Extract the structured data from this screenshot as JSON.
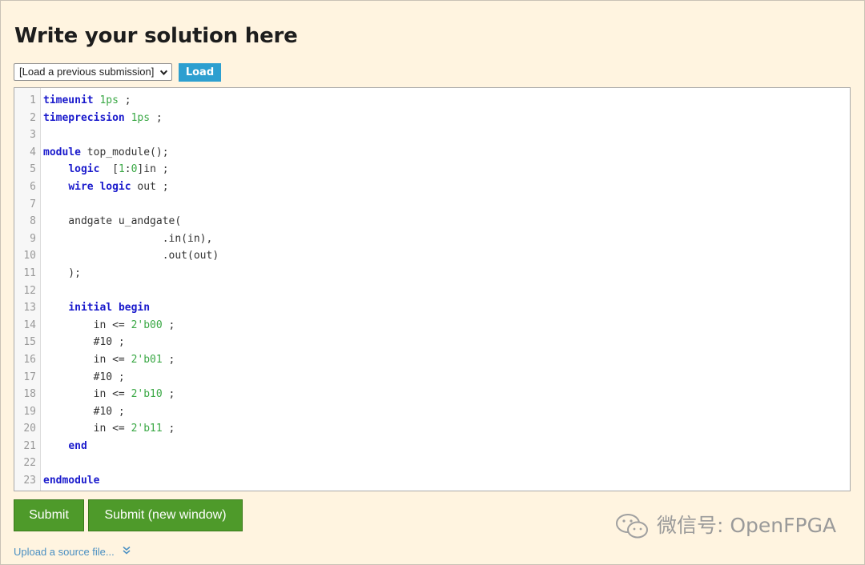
{
  "page": {
    "title": "Write your solution here"
  },
  "load_bar": {
    "select_value": "[Load a previous submission]",
    "load_label": "Load"
  },
  "editor": {
    "lines": [
      {
        "n": "1",
        "html": "<span class=\"kw\">timeunit</span> <span class=\"num\">1ps</span> ;"
      },
      {
        "n": "2",
        "html": "<span class=\"kw\">timeprecision</span> <span class=\"num\">1ps</span> ;"
      },
      {
        "n": "3",
        "html": ""
      },
      {
        "n": "4",
        "html": "<span class=\"kw\">module</span> top_module();"
      },
      {
        "n": "5",
        "html": "    <span class=\"kw\">logic</span>  [<span class=\"num\">1</span>:<span class=\"num\">0</span>]in ;"
      },
      {
        "n": "6",
        "html": "    <span class=\"kw\">wire</span> <span class=\"kw\">logic</span> out ;"
      },
      {
        "n": "7",
        "html": ""
      },
      {
        "n": "8",
        "html": "    andgate u_andgate("
      },
      {
        "n": "9",
        "html": "                   .in(in),"
      },
      {
        "n": "10",
        "html": "                   .out(out)"
      },
      {
        "n": "11",
        "html": "    );"
      },
      {
        "n": "12",
        "html": ""
      },
      {
        "n": "13",
        "html": "    <span class=\"kw\">initial</span> <span class=\"kw\">begin</span>"
      },
      {
        "n": "14",
        "html": "        in <= <span class=\"num\">2'b00</span> ;"
      },
      {
        "n": "15",
        "html": "        #10 ;"
      },
      {
        "n": "16",
        "html": "        in <= <span class=\"num\">2'b01</span> ;"
      },
      {
        "n": "17",
        "html": "        #10 ;"
      },
      {
        "n": "18",
        "html": "        in <= <span class=\"num\">2'b10</span> ;"
      },
      {
        "n": "19",
        "html": "        #10 ;"
      },
      {
        "n": "20",
        "html": "        in <= <span class=\"num\">2'b11</span> ;"
      },
      {
        "n": "21",
        "html": "    <span class=\"kw\">end</span>"
      },
      {
        "n": "22",
        "html": ""
      },
      {
        "n": "23",
        "html": "<span class=\"kw\">endmodule</span>"
      }
    ]
  },
  "actions": {
    "submit_label": "Submit",
    "submit_new_label": "Submit (new window)",
    "upload_label": "Upload a source file..."
  },
  "watermark": {
    "text": "微信号: OpenFPGA"
  },
  "colors": {
    "background": "#fff4e0",
    "load_button": "#2d9fd0",
    "submit_button": "#4e9a2a",
    "keyword": "#1a1acc",
    "number": "#3aa845",
    "link": "#4a8fc2"
  },
  "icons": {
    "select_arrow": "chevron-down-icon",
    "upload_expand": "double-chevron-down-icon",
    "watermark": "wechat-icon"
  }
}
